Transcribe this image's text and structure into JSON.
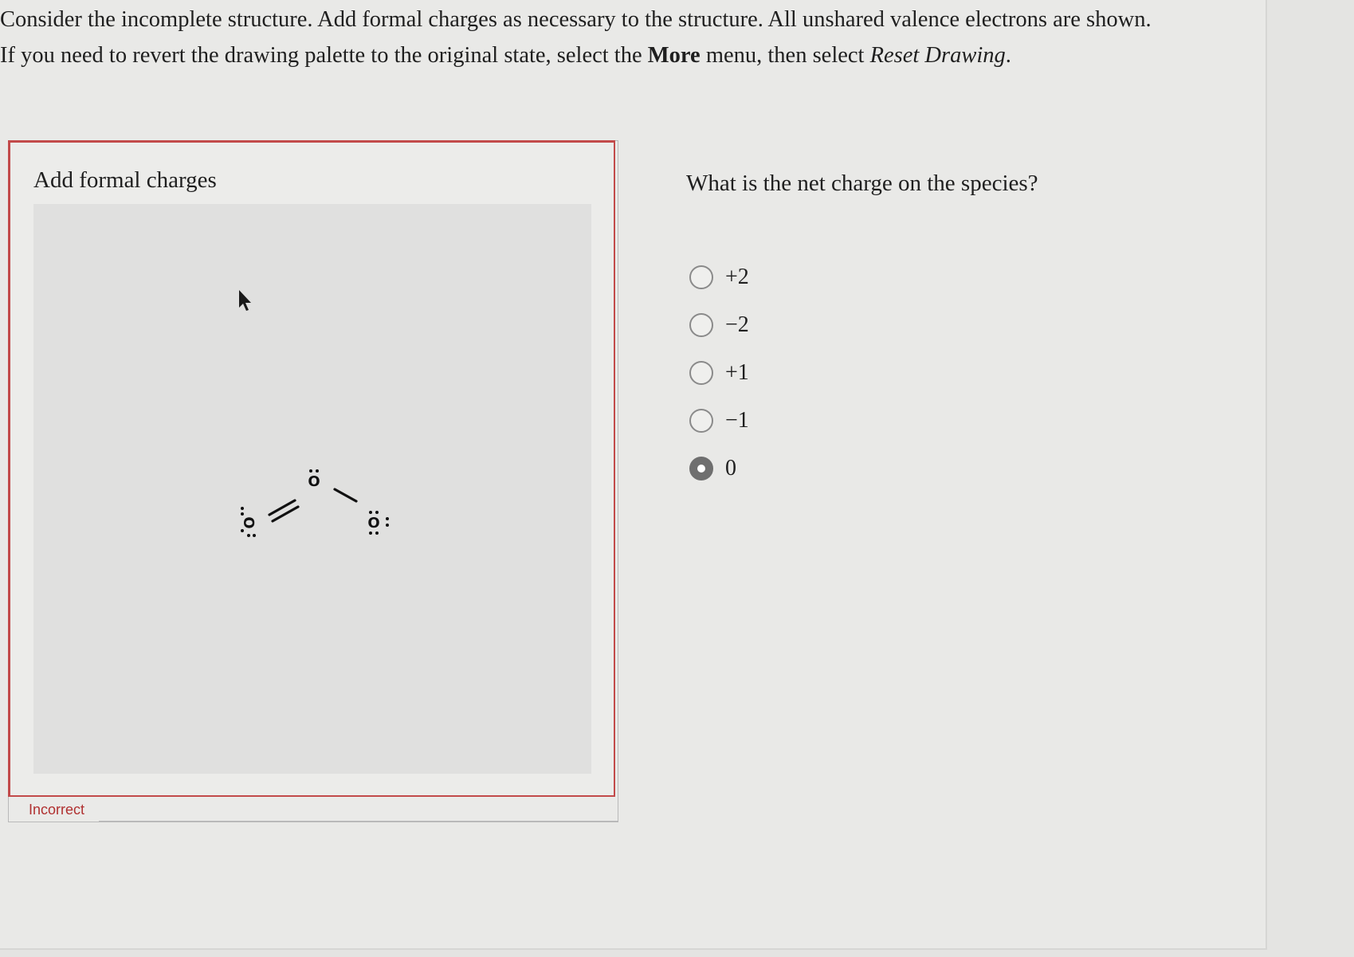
{
  "instructions": {
    "line1": "Consider the incomplete structure. Add formal charges as necessary to the structure. All unshared valence electrons are shown.",
    "line2_before": "If you need to revert the drawing palette to the original state, select the ",
    "line2_bold": "More",
    "line2_middle": " menu, then select ",
    "line2_italic": "Reset Drawing",
    "line2_end": "."
  },
  "drawing_panel": {
    "title": "Add formal charges",
    "atoms": {
      "left": "O",
      "center": "O",
      "right": "O"
    },
    "status": "Incorrect"
  },
  "question": {
    "prompt": "What is the net charge on the species?",
    "options": [
      {
        "label": "+2",
        "selected": false
      },
      {
        "label": "−2",
        "selected": false
      },
      {
        "label": "+1",
        "selected": false
      },
      {
        "label": "−1",
        "selected": false
      },
      {
        "label": "0",
        "selected": true
      }
    ]
  },
  "colors": {
    "error": "#c24a4a",
    "radio_selected": "#6f6f6f"
  }
}
